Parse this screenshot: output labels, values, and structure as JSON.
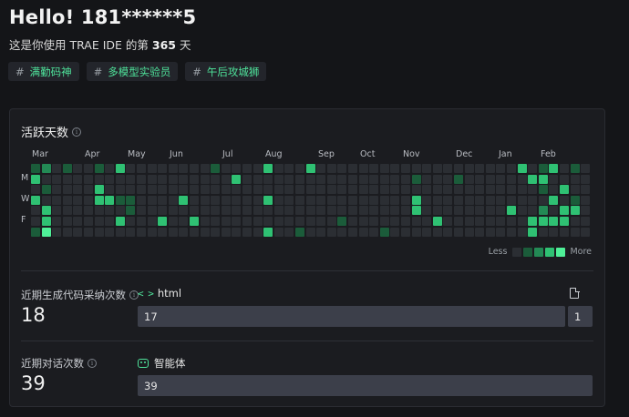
{
  "header": {
    "greeting": "Hello! 181******5",
    "subtitle_prefix": "这是你使用 TRAE IDE 的第",
    "days_count": "365",
    "subtitle_suffix": "天"
  },
  "tags": [
    {
      "hash": "#",
      "label": "满勤码神"
    },
    {
      "hash": "#",
      "label": "多模型实验员"
    },
    {
      "hash": "#",
      "label": "午后攻城狮"
    }
  ],
  "activity": {
    "title": "活跃天数",
    "info_glyph": "i",
    "months": [
      "Mar",
      "Apr",
      "May",
      "Jun",
      "Jul",
      "Aug",
      "Sep",
      "Oct",
      "Nov",
      "Dec",
      "Jan",
      "Feb"
    ],
    "day_labels": [
      "M",
      "W",
      "F"
    ],
    "legend_less": "Less",
    "legend_more": "More",
    "week_count": 53,
    "cells": [
      [
        0,
        0,
        1
      ],
      [
        0,
        1,
        3
      ],
      [
        0,
        3,
        3
      ],
      [
        0,
        6,
        1
      ],
      [
        1,
        0,
        2
      ],
      [
        1,
        2,
        1
      ],
      [
        1,
        4,
        3
      ],
      [
        1,
        5,
        3
      ],
      [
        1,
        6,
        4
      ],
      [
        3,
        0,
        1
      ],
      [
        6,
        0,
        1
      ],
      [
        6,
        2,
        3
      ],
      [
        6,
        3,
        3
      ],
      [
        7,
        3,
        3
      ],
      [
        8,
        0,
        3
      ],
      [
        8,
        3,
        1
      ],
      [
        8,
        5,
        3
      ],
      [
        9,
        3,
        1
      ],
      [
        9,
        4,
        1
      ],
      [
        12,
        5,
        3
      ],
      [
        14,
        3,
        3
      ],
      [
        15,
        5,
        3
      ],
      [
        17,
        0,
        1
      ],
      [
        19,
        1,
        3
      ],
      [
        22,
        0,
        3
      ],
      [
        22,
        3,
        3
      ],
      [
        22,
        6,
        3
      ],
      [
        25,
        6,
        1
      ],
      [
        26,
        0,
        3
      ],
      [
        29,
        5,
        1
      ],
      [
        33,
        6,
        1
      ],
      [
        36,
        1,
        1
      ],
      [
        36,
        3,
        3
      ],
      [
        36,
        4,
        3
      ],
      [
        38,
        5,
        3
      ],
      [
        40,
        1,
        1
      ],
      [
        45,
        4,
        3
      ],
      [
        46,
        0,
        3
      ],
      [
        47,
        1,
        3
      ],
      [
        47,
        5,
        3
      ],
      [
        47,
        6,
        3
      ],
      [
        48,
        0,
        1
      ],
      [
        48,
        1,
        3
      ],
      [
        48,
        2,
        1
      ],
      [
        48,
        4,
        2
      ],
      [
        48,
        5,
        3
      ],
      [
        49,
        0,
        3
      ],
      [
        49,
        3,
        3
      ],
      [
        49,
        5,
        3
      ],
      [
        50,
        2,
        3
      ],
      [
        50,
        4,
        3
      ],
      [
        50,
        5,
        3
      ],
      [
        51,
        0,
        1
      ],
      [
        51,
        3,
        1
      ],
      [
        51,
        4,
        3
      ]
    ]
  },
  "code_stats": {
    "label": "近期生成代码采纳次数",
    "value": "18",
    "language": "html",
    "code_glyph": "< >",
    "bar_main": "17",
    "bar_side": "1"
  },
  "chat_stats": {
    "label": "近期对话次数",
    "value": "39",
    "agent_label": "智能体",
    "bar_main": "39"
  }
}
